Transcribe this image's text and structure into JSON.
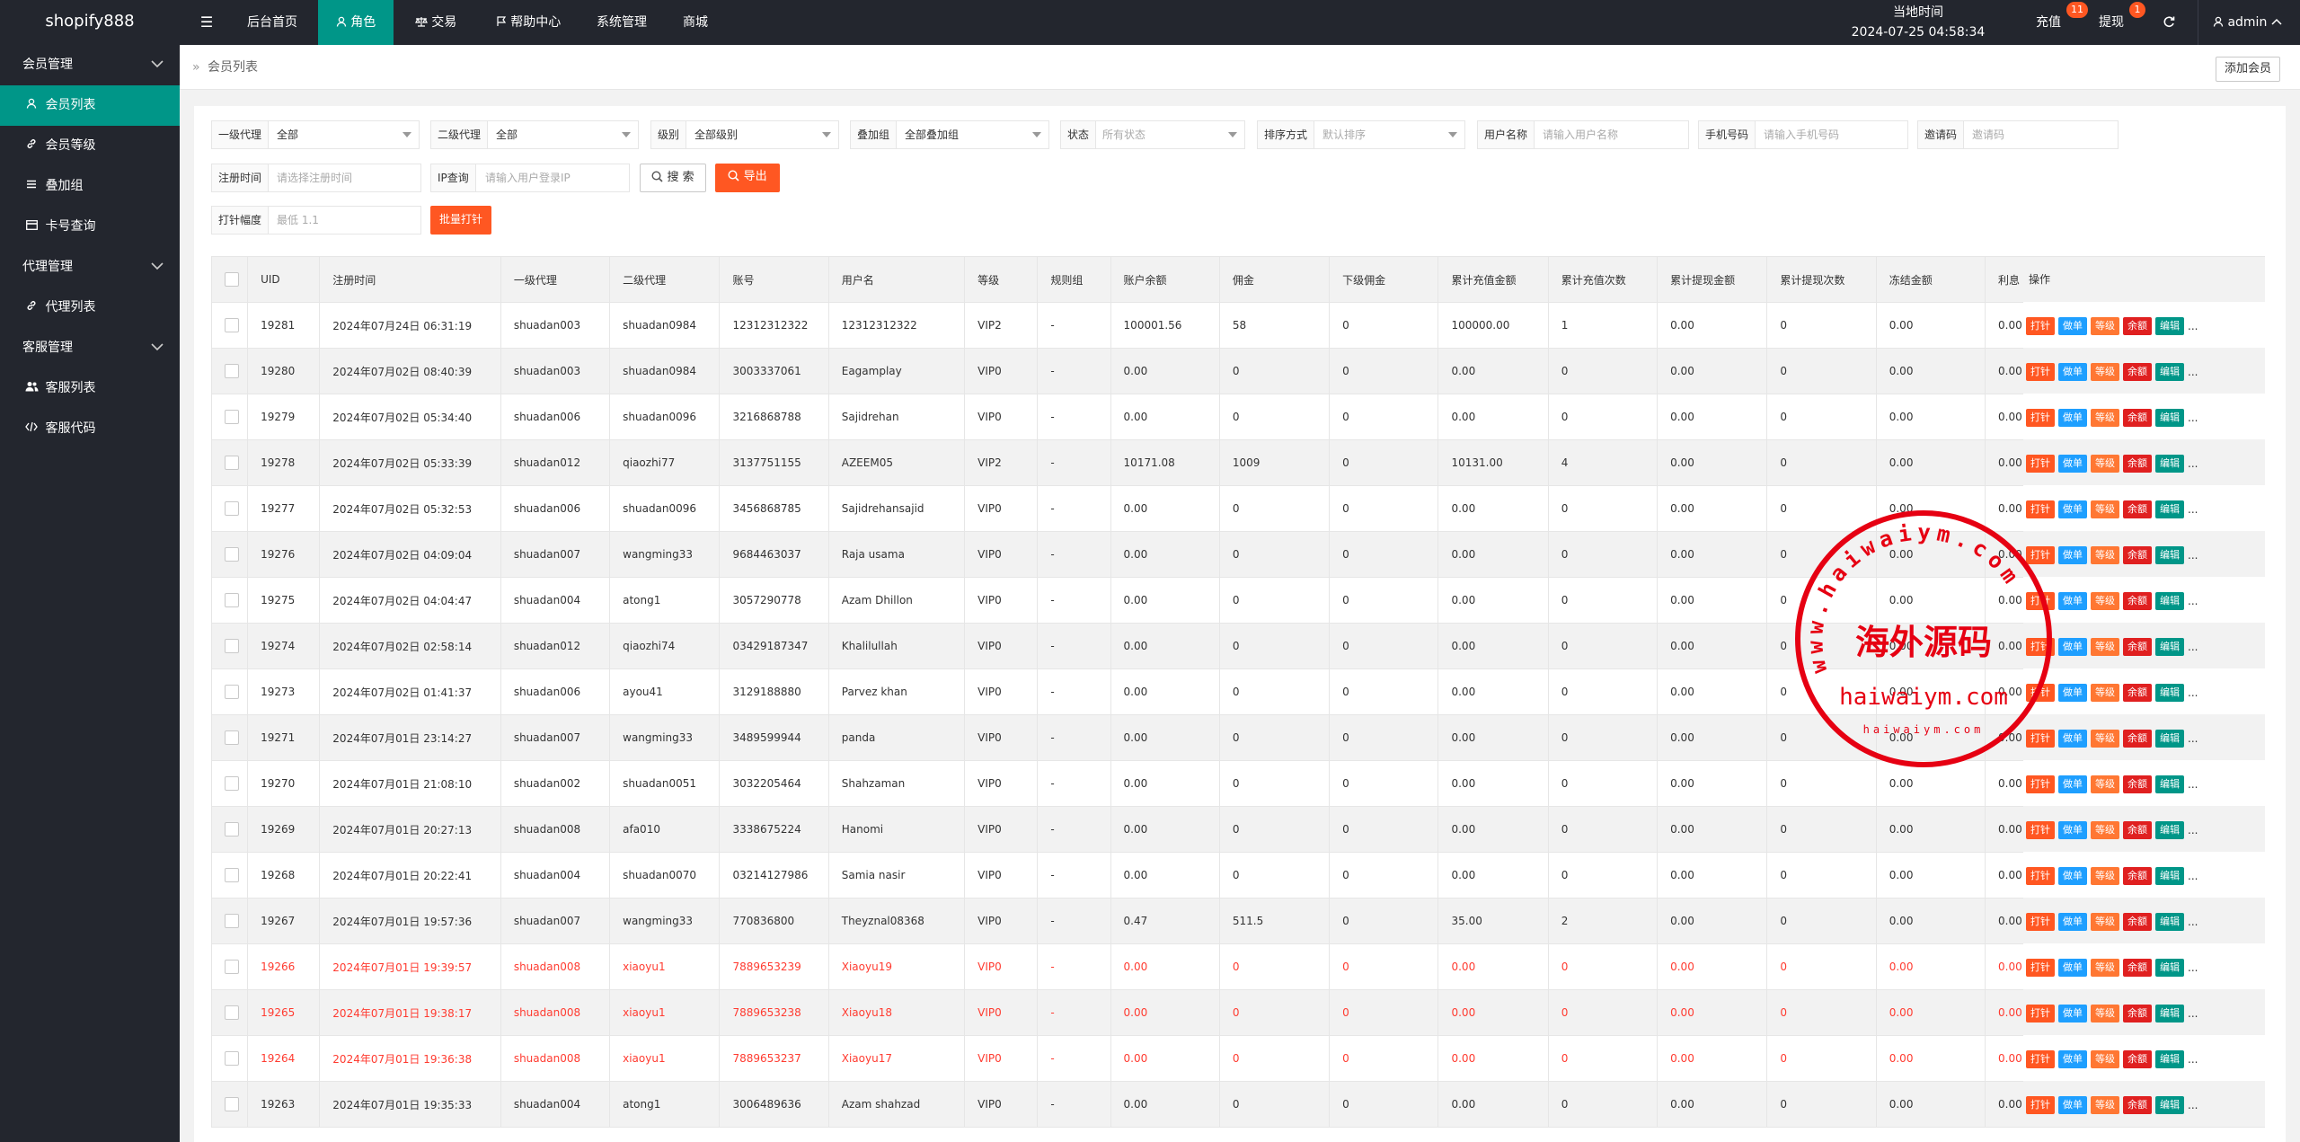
{
  "app": {
    "logo": "shopify888"
  },
  "topnav": {
    "toggle": "☰",
    "items": [
      {
        "label": "后台首页",
        "icon": "",
        "active": false
      },
      {
        "label": "角色",
        "icon": "user-icon",
        "active": true
      },
      {
        "label": "交易",
        "icon": "scale-icon",
        "active": false
      },
      {
        "label": "帮助中心",
        "icon": "flag-icon",
        "active": false
      },
      {
        "label": "系统管理",
        "icon": "",
        "active": false
      },
      {
        "label": "商城",
        "icon": "",
        "active": false
      }
    ],
    "clock_label": "当地时间",
    "clock_value": "2024-07-25 04:58:34",
    "recharge_label": "充值",
    "recharge_count": "11",
    "withdraw_label": "提现",
    "withdraw_count": "1",
    "refresh_icon": "refresh-icon",
    "user_label": "admin",
    "user_icon": "user-icon"
  },
  "sidebar": {
    "groups": [
      {
        "label": "会员管理",
        "items": [
          {
            "label": "会员列表",
            "icon": "user-icon",
            "active": true
          },
          {
            "label": "会员等级",
            "icon": "link-icon",
            "active": false
          },
          {
            "label": "叠加组",
            "icon": "list-icon",
            "active": false
          },
          {
            "label": "卡号查询",
            "icon": "card-icon",
            "active": false
          }
        ]
      },
      {
        "label": "代理管理",
        "items": [
          {
            "label": "代理列表",
            "icon": "link-icon",
            "active": false
          }
        ]
      },
      {
        "label": "客服管理",
        "items": [
          {
            "label": "客服列表",
            "icon": "users-icon",
            "active": false
          },
          {
            "label": "客服代码",
            "icon": "code-icon",
            "active": false
          }
        ]
      }
    ]
  },
  "breadcrumb": {
    "prefix": "»",
    "label": "会员列表",
    "add_button": "添加会员"
  },
  "filters": {
    "agent1": {
      "label": "一级代理",
      "value": "全部"
    },
    "agent2": {
      "label": "二级代理",
      "value": "全部"
    },
    "level": {
      "label": "级别",
      "value": "全部级别"
    },
    "stack_group": {
      "label": "叠加组",
      "value": "全部叠加组"
    },
    "status": {
      "label": "状态",
      "placeholder": "所有状态"
    },
    "sort": {
      "label": "排序方式",
      "placeholder": "默认排序"
    },
    "username": {
      "label": "用户名称",
      "placeholder": "请输入用户名称"
    },
    "phone": {
      "label": "手机号码",
      "placeholder": "请输入手机号码"
    },
    "invite": {
      "label": "邀请码",
      "placeholder": "邀请码"
    },
    "reg_time": {
      "label": "注册时间",
      "placeholder": "请选择注册时间"
    },
    "ip": {
      "label": "IP查询",
      "placeholder": "请输入用户登录IP"
    },
    "search_button": "搜 索",
    "export_button": "导出",
    "hit_range": {
      "label": "打针幅度",
      "placeholder": "最低 1.1"
    },
    "batch_button": "批量打针"
  },
  "table": {
    "headers": [
      "UID",
      "注册时间",
      "一级代理",
      "二级代理",
      "账号",
      "用户名",
      "等级",
      "规则组",
      "账户余额",
      "佣金",
      "下级佣金",
      "累计充值金额",
      "累计充值次数",
      "累计提现金额",
      "累计提现次数",
      "冻结金额",
      "利息",
      "操作"
    ],
    "actions": [
      "打针",
      "做单",
      "等级",
      "余额",
      "编辑"
    ],
    "more": "...",
    "rows": [
      {
        "uid": "19281",
        "reg": "2024年07月24日 06:31:19",
        "a1": "shuadan003",
        "a2": "shuadan0984",
        "acct": "12312312322",
        "name": "12312312322",
        "lvl": "VIP2",
        "rule": "-",
        "bal": "100001.56",
        "comm": "58",
        "sub": "0",
        "rc_amt": "100000.00",
        "rc_cnt": "1",
        "wd_amt": "0.00",
        "wd_cnt": "0",
        "frozen": "0.00",
        "intr": "0.00",
        "red": false
      },
      {
        "uid": "19280",
        "reg": "2024年07月02日 08:40:39",
        "a1": "shuadan003",
        "a2": "shuadan0984",
        "acct": "3003337061",
        "name": "Eagamplay",
        "lvl": "VIP0",
        "rule": "-",
        "bal": "0.00",
        "comm": "0",
        "sub": "0",
        "rc_amt": "0.00",
        "rc_cnt": "0",
        "wd_amt": "0.00",
        "wd_cnt": "0",
        "frozen": "0.00",
        "intr": "0.00",
        "red": false
      },
      {
        "uid": "19279",
        "reg": "2024年07月02日 05:34:40",
        "a1": "shuadan006",
        "a2": "shuadan0096",
        "acct": "3216868788",
        "name": "Sajidrehan",
        "lvl": "VIP0",
        "rule": "-",
        "bal": "0.00",
        "comm": "0",
        "sub": "0",
        "rc_amt": "0.00",
        "rc_cnt": "0",
        "wd_amt": "0.00",
        "wd_cnt": "0",
        "frozen": "0.00",
        "intr": "0.00",
        "red": false
      },
      {
        "uid": "19278",
        "reg": "2024年07月02日 05:33:39",
        "a1": "shuadan012",
        "a2": "qiaozhi77",
        "acct": "3137751155",
        "name": "AZEEM05",
        "lvl": "VIP2",
        "rule": "-",
        "bal": "10171.08",
        "comm": "1009",
        "sub": "0",
        "rc_amt": "10131.00",
        "rc_cnt": "4",
        "wd_amt": "0.00",
        "wd_cnt": "0",
        "frozen": "0.00",
        "intr": "0.00",
        "red": false
      },
      {
        "uid": "19277",
        "reg": "2024年07月02日 05:32:53",
        "a1": "shuadan006",
        "a2": "shuadan0096",
        "acct": "3456868785",
        "name": "Sajidrehansajid",
        "lvl": "VIP0",
        "rule": "-",
        "bal": "0.00",
        "comm": "0",
        "sub": "0",
        "rc_amt": "0.00",
        "rc_cnt": "0",
        "wd_amt": "0.00",
        "wd_cnt": "0",
        "frozen": "0.00",
        "intr": "0.00",
        "red": false
      },
      {
        "uid": "19276",
        "reg": "2024年07月02日 04:09:04",
        "a1": "shuadan007",
        "a2": "wangming33",
        "acct": "9684463037",
        "name": "Raja usama",
        "lvl": "VIP0",
        "rule": "-",
        "bal": "0.00",
        "comm": "0",
        "sub": "0",
        "rc_amt": "0.00",
        "rc_cnt": "0",
        "wd_amt": "0.00",
        "wd_cnt": "0",
        "frozen": "0.00",
        "intr": "0.00",
        "red": false
      },
      {
        "uid": "19275",
        "reg": "2024年07月02日 04:04:47",
        "a1": "shuadan004",
        "a2": "atong1",
        "acct": "3057290778",
        "name": "Azam Dhillon",
        "lvl": "VIP0",
        "rule": "-",
        "bal": "0.00",
        "comm": "0",
        "sub": "0",
        "rc_amt": "0.00",
        "rc_cnt": "0",
        "wd_amt": "0.00",
        "wd_cnt": "0",
        "frozen": "0.00",
        "intr": "0.00",
        "red": false
      },
      {
        "uid": "19274",
        "reg": "2024年07月02日 02:58:14",
        "a1": "shuadan012",
        "a2": "qiaozhi74",
        "acct": "03429187347",
        "name": "Khalilullah",
        "lvl": "VIP0",
        "rule": "-",
        "bal": "0.00",
        "comm": "0",
        "sub": "0",
        "rc_amt": "0.00",
        "rc_cnt": "0",
        "wd_amt": "0.00",
        "wd_cnt": "0",
        "frozen": "0.00",
        "intr": "0.00",
        "red": false
      },
      {
        "uid": "19273",
        "reg": "2024年07月02日 01:41:37",
        "a1": "shuadan006",
        "a2": "ayou41",
        "acct": "3129188880",
        "name": "Parvez khan",
        "lvl": "VIP0",
        "rule": "-",
        "bal": "0.00",
        "comm": "0",
        "sub": "0",
        "rc_amt": "0.00",
        "rc_cnt": "0",
        "wd_amt": "0.00",
        "wd_cnt": "0",
        "frozen": "0.00",
        "intr": "0.00",
        "red": false
      },
      {
        "uid": "19271",
        "reg": "2024年07月01日 23:14:27",
        "a1": "shuadan007",
        "a2": "wangming33",
        "acct": "3489599944",
        "name": "panda",
        "lvl": "VIP0",
        "rule": "-",
        "bal": "0.00",
        "comm": "0",
        "sub": "0",
        "rc_amt": "0.00",
        "rc_cnt": "0",
        "wd_amt": "0.00",
        "wd_cnt": "0",
        "frozen": "0.00",
        "intr": "0.00",
        "red": false
      },
      {
        "uid": "19270",
        "reg": "2024年07月01日 21:08:10",
        "a1": "shuadan002",
        "a2": "shuadan0051",
        "acct": "3032205464",
        "name": "Shahzaman",
        "lvl": "VIP0",
        "rule": "-",
        "bal": "0.00",
        "comm": "0",
        "sub": "0",
        "rc_amt": "0.00",
        "rc_cnt": "0",
        "wd_amt": "0.00",
        "wd_cnt": "0",
        "frozen": "0.00",
        "intr": "0.00",
        "red": false
      },
      {
        "uid": "19269",
        "reg": "2024年07月01日 20:27:13",
        "a1": "shuadan008",
        "a2": "afa010",
        "acct": "3338675224",
        "name": "Hanomi",
        "lvl": "VIP0",
        "rule": "-",
        "bal": "0.00",
        "comm": "0",
        "sub": "0",
        "rc_amt": "0.00",
        "rc_cnt": "0",
        "wd_amt": "0.00",
        "wd_cnt": "0",
        "frozen": "0.00",
        "intr": "0.00",
        "red": false
      },
      {
        "uid": "19268",
        "reg": "2024年07月01日 20:22:41",
        "a1": "shuadan004",
        "a2": "shuadan0070",
        "acct": "03214127986",
        "name": "Samia nasir",
        "lvl": "VIP0",
        "rule": "-",
        "bal": "0.00",
        "comm": "0",
        "sub": "0",
        "rc_amt": "0.00",
        "rc_cnt": "0",
        "wd_amt": "0.00",
        "wd_cnt": "0",
        "frozen": "0.00",
        "intr": "0.00",
        "red": false
      },
      {
        "uid": "19267",
        "reg": "2024年07月01日 19:57:36",
        "a1": "shuadan007",
        "a2": "wangming33",
        "acct": "770836800",
        "name": "Theyznal08368",
        "lvl": "VIP0",
        "rule": "-",
        "bal": "0.47",
        "comm": "511.5",
        "sub": "0",
        "rc_amt": "35.00",
        "rc_cnt": "2",
        "wd_amt": "0.00",
        "wd_cnt": "0",
        "frozen": "0.00",
        "intr": "0.00",
        "red": false
      },
      {
        "uid": "19266",
        "reg": "2024年07月01日 19:39:57",
        "a1": "shuadan008",
        "a2": "xiaoyu1",
        "acct": "7889653239",
        "name": "Xiaoyu19",
        "lvl": "VIP0",
        "rule": "-",
        "bal": "0.00",
        "comm": "0",
        "sub": "0",
        "rc_amt": "0.00",
        "rc_cnt": "0",
        "wd_amt": "0.00",
        "wd_cnt": "0",
        "frozen": "0.00",
        "intr": "0.00",
        "red": true
      },
      {
        "uid": "19265",
        "reg": "2024年07月01日 19:38:17",
        "a1": "shuadan008",
        "a2": "xiaoyu1",
        "acct": "7889653238",
        "name": "Xiaoyu18",
        "lvl": "VIP0",
        "rule": "-",
        "bal": "0.00",
        "comm": "0",
        "sub": "0",
        "rc_amt": "0.00",
        "rc_cnt": "0",
        "wd_amt": "0.00",
        "wd_cnt": "0",
        "frozen": "0.00",
        "intr": "0.00",
        "red": true
      },
      {
        "uid": "19264",
        "reg": "2024年07月01日 19:36:38",
        "a1": "shuadan008",
        "a2": "xiaoyu1",
        "acct": "7889653237",
        "name": "Xiaoyu17",
        "lvl": "VIP0",
        "rule": "-",
        "bal": "0.00",
        "comm": "0",
        "sub": "0",
        "rc_amt": "0.00",
        "rc_cnt": "0",
        "wd_amt": "0.00",
        "wd_cnt": "0",
        "frozen": "0.00",
        "intr": "0.00",
        "red": true
      },
      {
        "uid": "19263",
        "reg": "2024年07月01日 19:35:33",
        "a1": "shuadan004",
        "a2": "atong1",
        "acct": "3006489636",
        "name": "Azam shahzad",
        "lvl": "VIP0",
        "rule": "-",
        "bal": "0.00",
        "comm": "0",
        "sub": "0",
        "rc_amt": "0.00",
        "rc_cnt": "0",
        "wd_amt": "0.00",
        "wd_cnt": "0",
        "frozen": "0.00",
        "intr": "0.00",
        "red": false
      }
    ]
  },
  "watermark": {
    "ring_text": "www.haiwaiym.com",
    "center_text": "海外源码",
    "bottom_text": "haiwaiym.com",
    "small_text": "haiwaiym.com",
    "color": "#e60012"
  },
  "colors": {
    "accent": "#009688",
    "dark": "#23262e",
    "orange": "#ff5722",
    "blue": "#1e9fff",
    "red": "#e02020"
  }
}
